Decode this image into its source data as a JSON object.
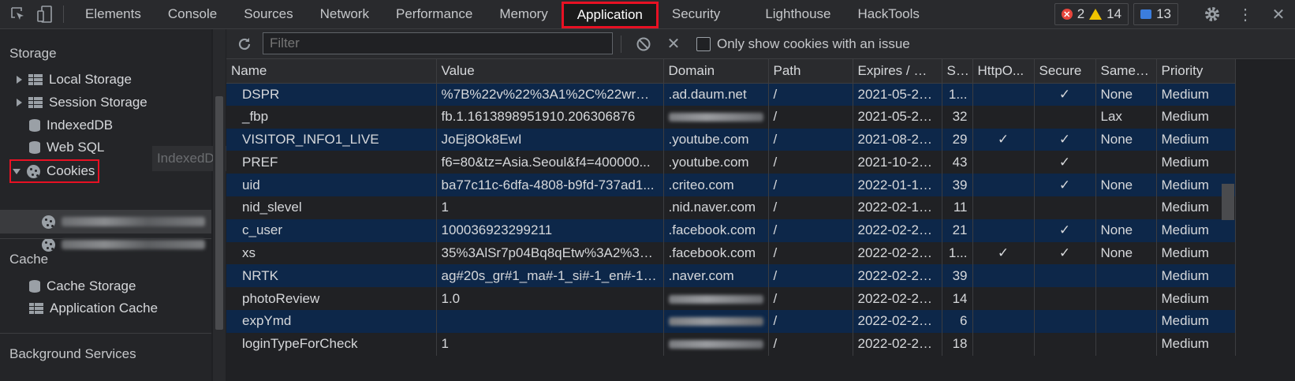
{
  "devtools": {
    "tabs": [
      "Elements",
      "Console",
      "Sources",
      "Network",
      "Performance",
      "Memory",
      "Application",
      "Security",
      "Lighthouse",
      "HackTools"
    ],
    "active_tab": "Application",
    "errors": "2",
    "warnings": "14",
    "messages": "13",
    "accent_color": "#e81123"
  },
  "sidebar": {
    "storage_heading": "Storage",
    "local_storage": "Local Storage",
    "session_storage": "Session Storage",
    "indexeddb": "IndexedDB",
    "web_sql": "Web SQL",
    "cookies": "Cookies",
    "cache_heading": "Cache",
    "cache_storage": "Cache Storage",
    "application_cache": "Application Cache",
    "background_heading": "Background Services",
    "tooltip": "IndexedDB"
  },
  "toolbar": {
    "filter_placeholder": "Filter",
    "only_issues_label": "Only show cookies with an issue"
  },
  "table": {
    "columns": [
      "Name",
      "Value",
      "Domain",
      "Path",
      "Expires / M...",
      "Si...",
      "HttpO...",
      "Secure",
      "SameS...",
      "Priority"
    ],
    "rows": [
      [
        "DSPR",
        "%7B%22v%22%3A1%2C%22wr%2...",
        ".ad.daum.net",
        "/",
        "2021-05-22...",
        "1...",
        "",
        "✓",
        "None",
        "Medium"
      ],
      [
        "_fbp",
        "fb.1.1613898951910.206306876",
        "",
        "/",
        "2021-05-22...",
        "32",
        "",
        "",
        "Lax",
        "Medium"
      ],
      [
        "VISITOR_INFO1_LIVE",
        "JoEj8Ok8EwI",
        ".youtube.com",
        "/",
        "2021-08-20...",
        "29",
        "✓",
        "✓",
        "None",
        "Medium"
      ],
      [
        "PREF",
        "f6=80&tz=Asia.Seoul&f4=400000...",
        ".youtube.com",
        "/",
        "2021-10-22...",
        "43",
        "",
        "✓",
        "",
        "Medium"
      ],
      [
        "uid",
        "ba77c11c-6dfa-4808-b9fd-737ad1...",
        ".criteo.com",
        "/",
        "2022-01-14...",
        "39",
        "",
        "✓",
        "None",
        "Medium"
      ],
      [
        "nid_slevel",
        "1",
        ".nid.naver.com",
        "/",
        "2022-02-18...",
        "11",
        "",
        "",
        "",
        "Medium"
      ],
      [
        "c_user",
        "100036923299211",
        ".facebook.com",
        "/",
        "2022-02-20...",
        "21",
        "",
        "✓",
        "None",
        "Medium"
      ],
      [
        "xs",
        "35%3AlSr7p04Bq8qEtw%3A2%3A...",
        ".facebook.com",
        "/",
        "2022-02-20...",
        "1...",
        "✓",
        "✓",
        "None",
        "Medium"
      ],
      [
        "NRTK",
        "ag#20s_gr#1_ma#-1_si#-1_en#-1_...",
        ".naver.com",
        "/",
        "2022-02-21...",
        "39",
        "",
        "",
        "",
        "Medium"
      ],
      [
        "photoReview",
        "1.0",
        "",
        "/",
        "2022-02-21...",
        "14",
        "",
        "",
        "",
        "Medium"
      ],
      [
        "expYmd",
        "",
        "",
        "/",
        "2022-02-21...",
        "6",
        "",
        "",
        "",
        "Medium"
      ],
      [
        "loginTypeForCheck",
        "1",
        "",
        "/",
        "2022-02-21...",
        "18",
        "",
        "",
        "",
        "Medium"
      ]
    ]
  }
}
